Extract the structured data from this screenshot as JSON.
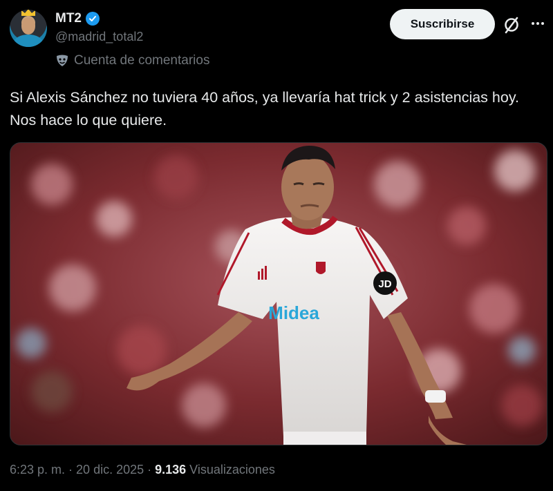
{
  "author": {
    "display_name": "MT2",
    "handle": "@madrid_total2",
    "account_label": "Cuenta de comentarios",
    "verified": true
  },
  "actions": {
    "subscribe_label": "Suscribirse"
  },
  "tweet": {
    "text": "Si Alexis Sánchez no tuviera 40 años, ya llevaría hat trick y 2 asistencias hoy. Nos hace lo que quiere.",
    "media": {
      "jersey_sponsor": "Midea",
      "sleeve_badge": "JD"
    }
  },
  "meta": {
    "time": "6:23 p. m.",
    "separator1": "·",
    "date": "20 dic. 2025",
    "separator2": "·",
    "views_count": "9.136",
    "views_label": "Visualizaciones"
  },
  "colors": {
    "verified": "#1d9bf0",
    "button_bg": "#eff3f4",
    "muted_text": "#71767b",
    "jersey_red": "#b0182a"
  }
}
